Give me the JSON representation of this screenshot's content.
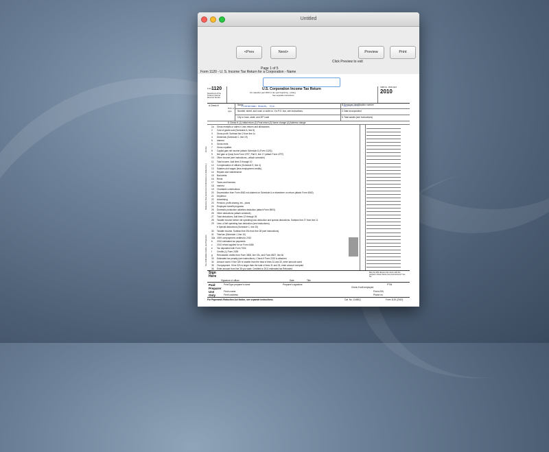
{
  "window": {
    "title": "Untitled"
  },
  "toolbar": {
    "prev_label": "<Prev",
    "next_label": "Next>",
    "preview_label": "Preview",
    "print_label": "Print",
    "page_indicator": "Page 1 of 5",
    "preview_hint": "Click Preview to exit",
    "form_title": "Form 1120 - U. S. Income Tax Return for a Corporation - Name"
  },
  "form": {
    "form_number": "1120",
    "heading": "U.S. Corporation Income Tax Return",
    "year": "2010",
    "cal_year_note": "For calendar year 2010 or tax year beginning , ending",
    "instructions_note": "See separate instructions.",
    "omb": "OMB No. 1545-0123",
    "dept": "Department of the Treasury Internal Revenue Service",
    "check_if": "A Check if:",
    "print_or_type": "Print or type",
    "name_label": "Name",
    "name_value": "Fisherman Goods, Inc.",
    "ein_label": "B Employer identification number",
    "ein_value": "75-*******",
    "address_label": "Number, street, and room or suite no. If a P.O. box, see instructions.",
    "date_label": "C Date incorporated",
    "city_label": "City or town, state, and ZIP code",
    "assets_label": "D Total assets (see instructions)",
    "check_e": "E Check if: (1) Initial return (2) Final return (3) Name change (4) Address change",
    "sections": {
      "income": "Income",
      "deductions": "Deductions (See instructions for limitations on deductions.)",
      "tax": "Tax, Refundable Credits, and Payments"
    },
    "lines": [
      {
        "n": "1a",
        "t": "Gross receipts or sales  b Less returns and allowances"
      },
      {
        "n": "2",
        "t": "Cost of goods sold (Schedule A, line 8)"
      },
      {
        "n": "3",
        "t": "Gross profit. Subtract line 2 from line 1c"
      },
      {
        "n": "4",
        "t": "Dividends (Schedule C, line 19)"
      },
      {
        "n": "5",
        "t": "Interest"
      },
      {
        "n": "6",
        "t": "Gross rents"
      },
      {
        "n": "7",
        "t": "Gross royalties"
      },
      {
        "n": "8",
        "t": "Capital gain net income (attach Schedule D (Form 1120))"
      },
      {
        "n": "9",
        "t": "Net gain or (loss) from Form 4797, Part II, line 17 (attach Form 4797)"
      },
      {
        "n": "10",
        "t": "Other income (see instructions—attach schedule)"
      },
      {
        "n": "11",
        "t": "Total income. Add lines 3 through 10"
      },
      {
        "n": "12",
        "t": "Compensation of officers (Schedule E, line 4)"
      },
      {
        "n": "13",
        "t": "Salaries and wages (less employment credits)"
      },
      {
        "n": "14",
        "t": "Repairs and maintenance"
      },
      {
        "n": "15",
        "t": "Bad debts"
      },
      {
        "n": "16",
        "t": "Rents"
      },
      {
        "n": "17",
        "t": "Taxes and licenses"
      },
      {
        "n": "18",
        "t": "Interest"
      },
      {
        "n": "19",
        "t": "Charitable contributions"
      },
      {
        "n": "20",
        "t": "Depreciation from Form 4562 not claimed on Schedule A or elsewhere on return (attach Form 4562)"
      },
      {
        "n": "21",
        "t": "Depletion"
      },
      {
        "n": "22",
        "t": "Advertising"
      },
      {
        "n": "23",
        "t": "Pension, profit-sharing, etc., plans"
      },
      {
        "n": "24",
        "t": "Employee benefit programs"
      },
      {
        "n": "25",
        "t": "Domestic production activities deduction (attach Form 8903)"
      },
      {
        "n": "26",
        "t": "Other deductions (attach schedule)"
      },
      {
        "n": "27",
        "t": "Total deductions. Add lines 12 through 26"
      },
      {
        "n": "28",
        "t": "Taxable income before net operating loss deduction and special deductions. Subtract line 27 from line 11"
      },
      {
        "n": "29",
        "t": "Less: a Net operating loss deduction (see instructions)"
      },
      {
        "n": "",
        "t": "b Special deductions (Schedule C, line 20)"
      },
      {
        "n": "30",
        "t": "Taxable income. Subtract line 29c from line 28 (see instructions)"
      },
      {
        "n": "31",
        "t": "Total tax (Schedule J, line 10)"
      },
      {
        "n": "32a",
        "t": "2009 overpayment credited to 2010"
      },
      {
        "n": "b",
        "t": "2010 estimated tax payments"
      },
      {
        "n": "c",
        "t": "2010 refund applied for on Form 4466"
      },
      {
        "n": "e",
        "t": "Tax deposited with Form 7004"
      },
      {
        "n": "f",
        "t": "Credits (1) Form 2439"
      },
      {
        "n": "g",
        "t": "Refundable credits from Form 3800, line 19c, and Form 8827, line 8c"
      },
      {
        "n": "33",
        "t": "Estimated tax penalty (see instructions). Check if Form 2220 is attached"
      },
      {
        "n": "34",
        "t": "Amount owed. If line 32h is smaller than the total of lines 31 and 33, enter amount owed"
      },
      {
        "n": "35",
        "t": "Overpayment. If line 32h is larger than the total of lines 31 and 33, enter amount overpaid"
      },
      {
        "n": "36",
        "t": "Enter amount from line 35 you want: Credited to 2011 estimated tax  Refunded"
      }
    ],
    "sign_here": "Sign Here",
    "signature_label": "Signature of officer",
    "date_label2": "Date",
    "title_label": "Title",
    "may_discuss": "May the IRS discuss this return with the preparer shown below (see instructions)? Yes No",
    "paid_preparer": "Paid Preparer Use Only",
    "preparer_name": "Print/Type preparer's name",
    "preparer_sig": "Preparer's signature",
    "ptin": "PTIN",
    "check_self": "Check if self-employed",
    "firm_name": "Firm's name",
    "firm_ein": "Firm's EIN",
    "firm_address": "Firm's address",
    "phone": "Phone no.",
    "footer_left": "For Paperwork Reduction Act Notice, see separate instructions.",
    "footer_cat": "Cat. No. 11450Q",
    "footer_right": "Form 1120 (2010)"
  }
}
